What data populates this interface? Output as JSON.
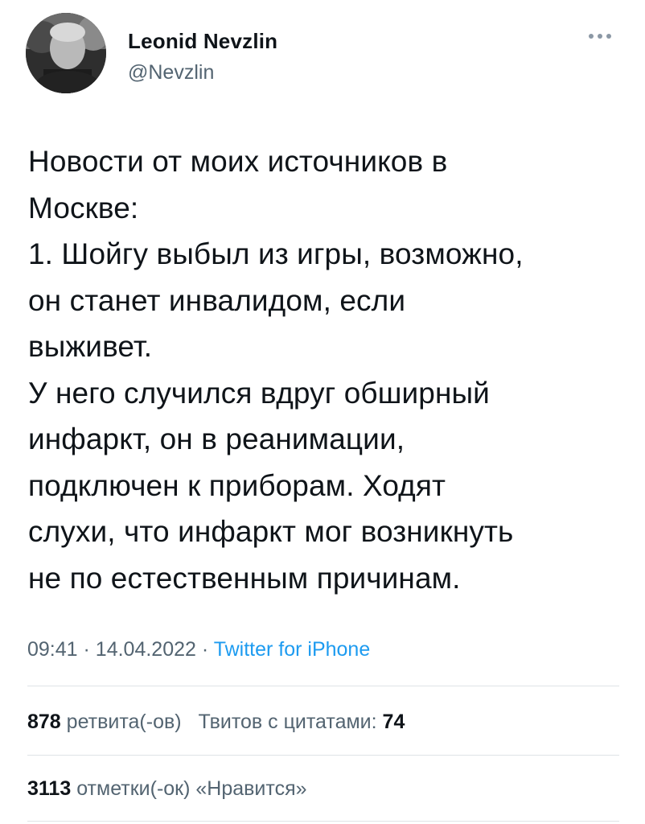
{
  "author": {
    "display_name": "Leonid Nevzlin",
    "handle": "@Nevzlin"
  },
  "tweet": {
    "lines": [
      "Новости от моих источников в",
      "Москве:",
      "1. Шойгу выбыл из игры, возможно,",
      "он станет инвалидом, если",
      "выживет.",
      "У него случился вдруг обширный",
      "инфаркт, он в реанимации,",
      "подключен к приборам. Ходят",
      "слухи, что инфаркт мог возникнуть",
      "не по естественным причинам."
    ],
    "time": "09:41",
    "date": "14.04.2022",
    "source": "Twitter for iPhone",
    "separator": "·"
  },
  "stats": {
    "retweets_count": "878",
    "retweets_label": "ретвита(-ов)",
    "quotes_label": "Твитов с цитатами:",
    "quotes_count": "74",
    "likes_count": "3113",
    "likes_label": "отметки(-ок) «Нравится»"
  },
  "icons": {
    "more": "more-horizontal-icon"
  },
  "colors": {
    "text": "#0f1419",
    "secondary": "#536471",
    "link": "#1d9bf0",
    "divider": "#dfe3e6"
  }
}
